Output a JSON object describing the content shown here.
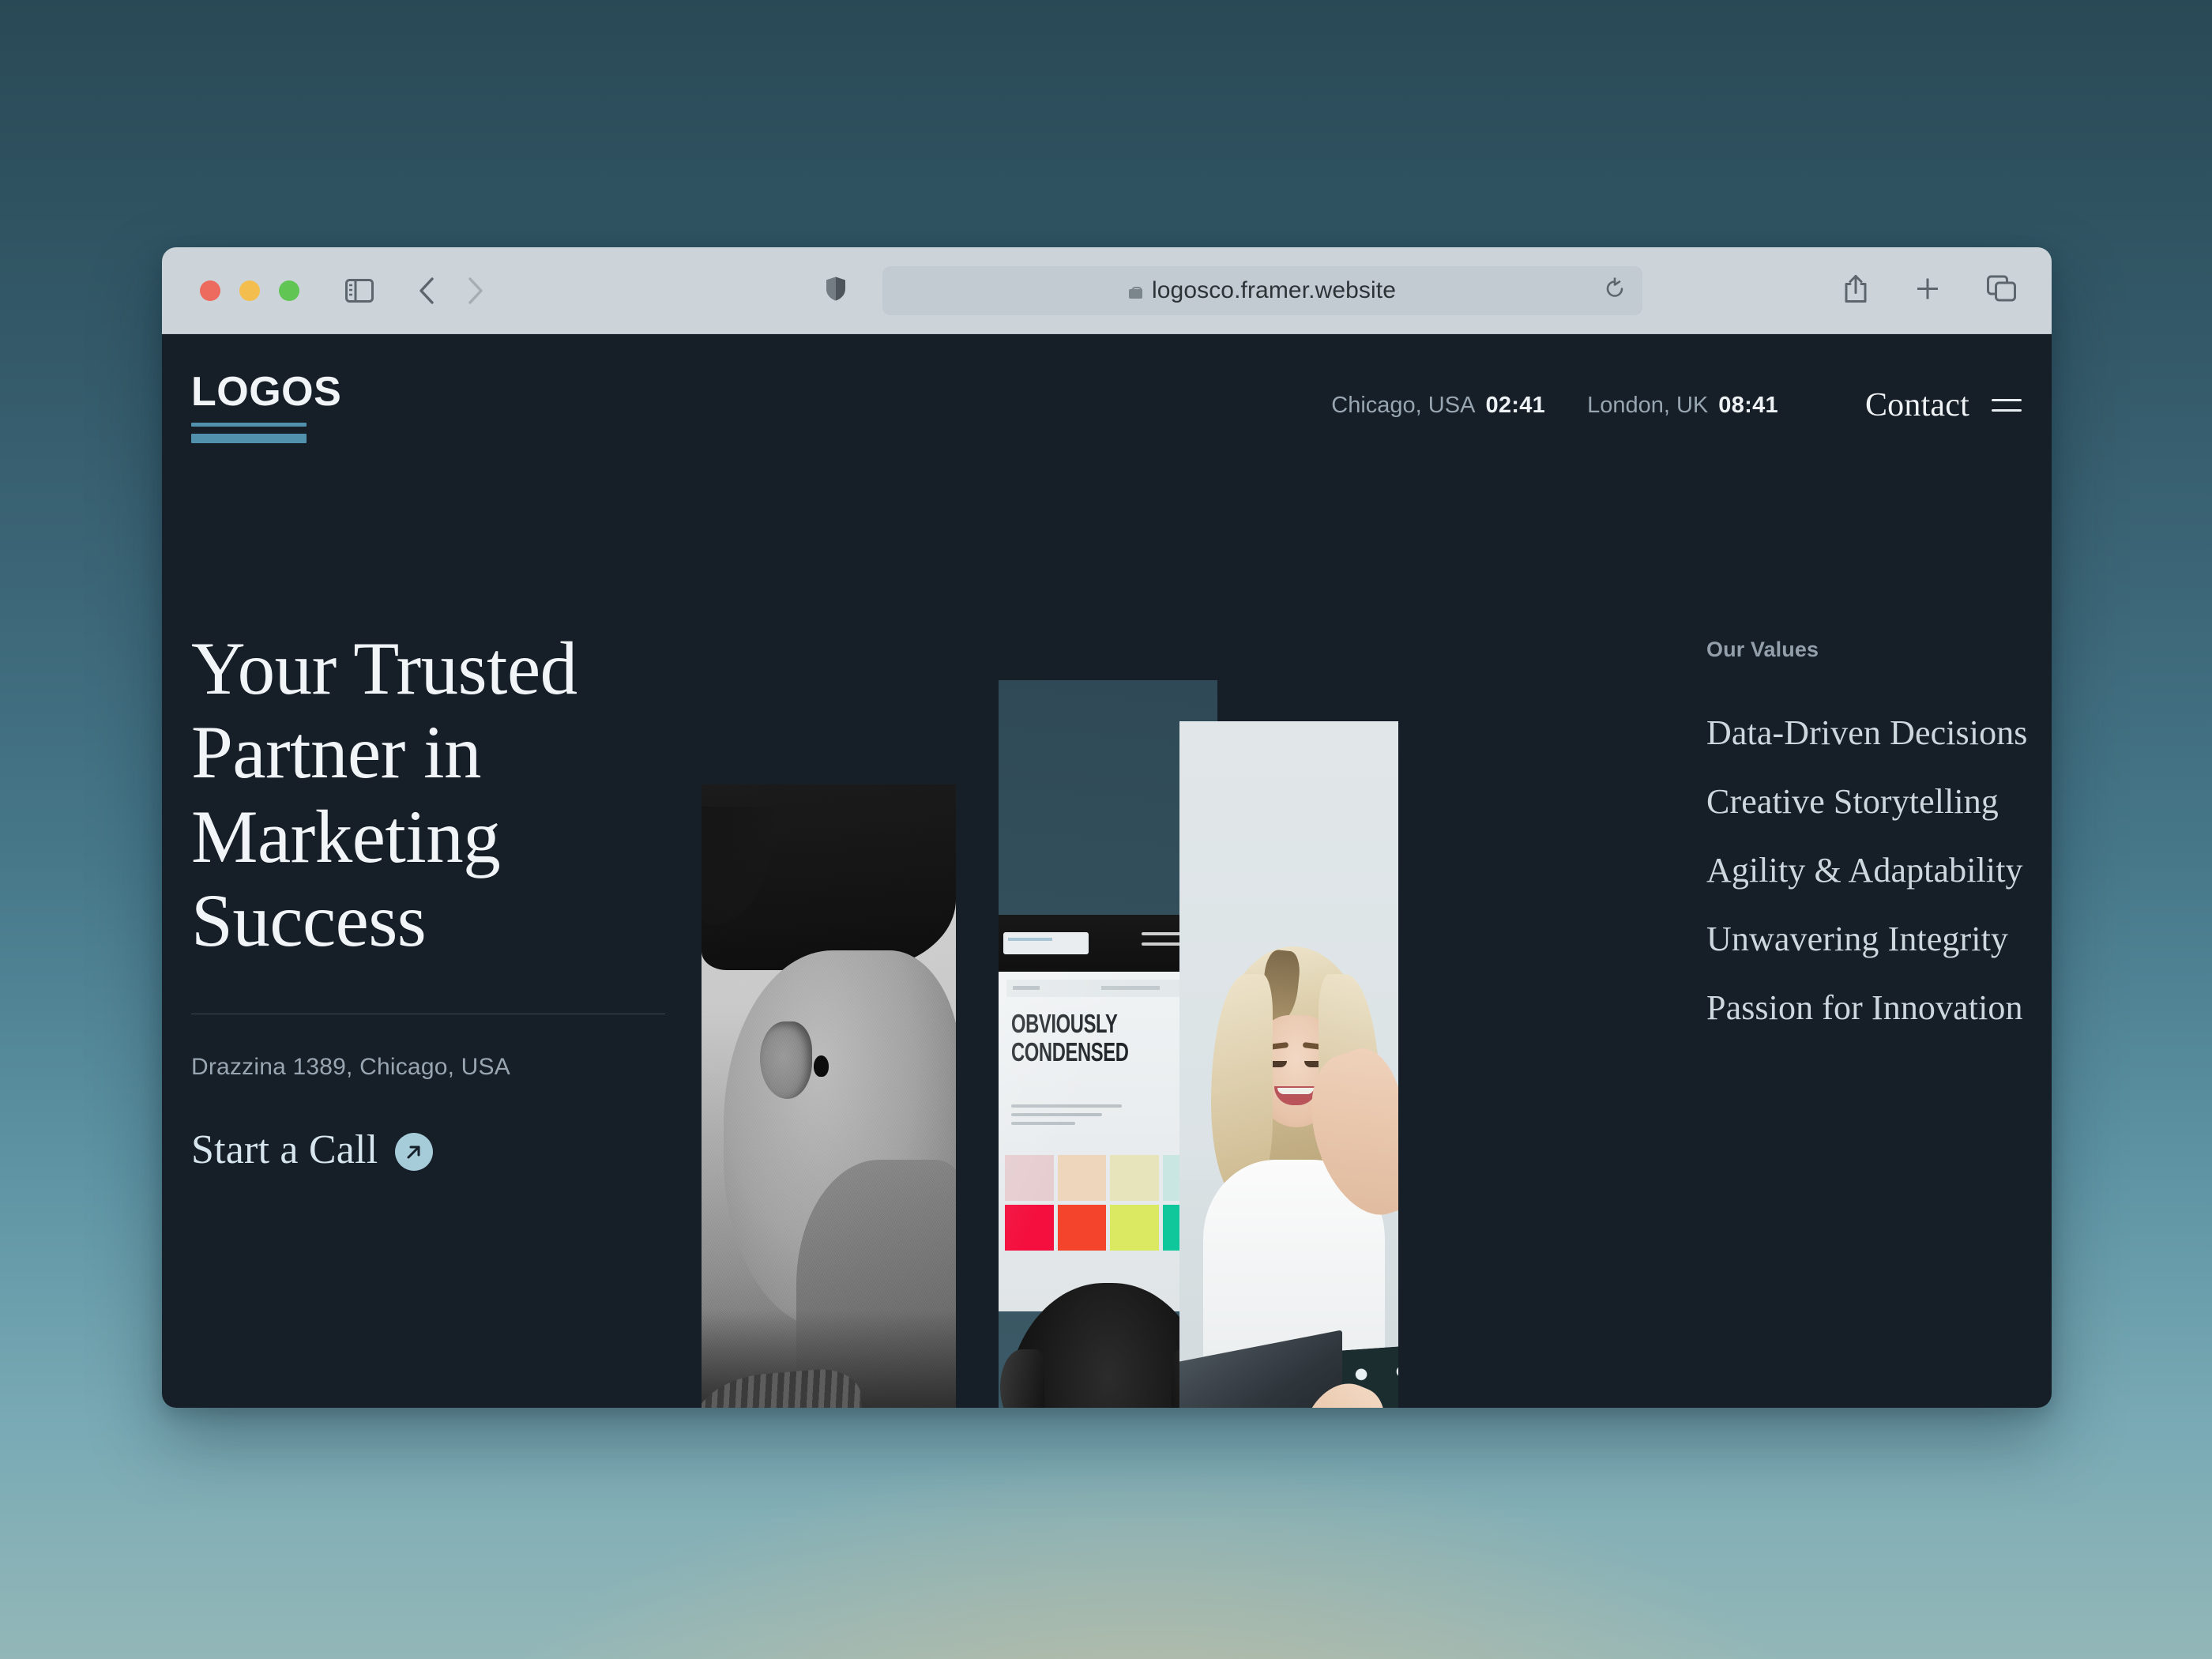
{
  "browser": {
    "url": "logosco.framer.website",
    "lock_icon": "lock-icon",
    "traffic_lights": [
      "close-red",
      "minimize-yellow",
      "zoom-green"
    ],
    "icons": {
      "sidebar": "sidebar-toggle-icon",
      "back": "back-chevron-icon",
      "forward": "forward-chevron-icon",
      "shield": "privacy-shield-icon",
      "reload": "reload-icon",
      "share": "share-icon",
      "new_tab": "plus-icon",
      "tabs": "tab-overview-icon"
    }
  },
  "site": {
    "logo": "LOGOS",
    "clocks": [
      {
        "city": "Chicago, USA",
        "time": "02:41"
      },
      {
        "city": "London, UK",
        "time": "08:41"
      }
    ],
    "contact_label": "Contact",
    "menu_icon": "hamburger-menu-icon"
  },
  "hero": {
    "title": "Your Trusted Partner in Marketing Success",
    "address": "Drazzina 1389, Chicago, USA",
    "cta_label": "Start a Call",
    "cta_icon": "arrow-up-right-icon"
  },
  "values": {
    "label": "Our Values",
    "items": [
      "Data-Driven Decisions",
      "Creative Storytelling",
      "Agility & Adaptability",
      "Unwavering Integrity",
      "Passion for Innovation"
    ]
  },
  "collage": {
    "panel_portrait": "black-and-white-portrait-photo",
    "panel_screens": "designer-workstation-photo",
    "panel_office": "smiling-woman-with-laptop-photo",
    "screen_headline": "OBVIOUSLY\nCONDENSED",
    "swatch_colors": [
      "#e6cdd0",
      "#edd6bc",
      "#e7e4bb",
      "#c9e6e2",
      "#f40f3e",
      "#f4452c",
      "#dbe861",
      "#0fc79b"
    ]
  },
  "theme": {
    "page_bg": "#161e28",
    "accent_blue": "#5291ad",
    "cta_circle": "#a6cbd9",
    "text_primary": "#f2f5f8",
    "text_muted": "#99a6b1",
    "desktop_gradient_top": "#2a4956",
    "desktop_gradient_bottom": "#93b7b8"
  }
}
